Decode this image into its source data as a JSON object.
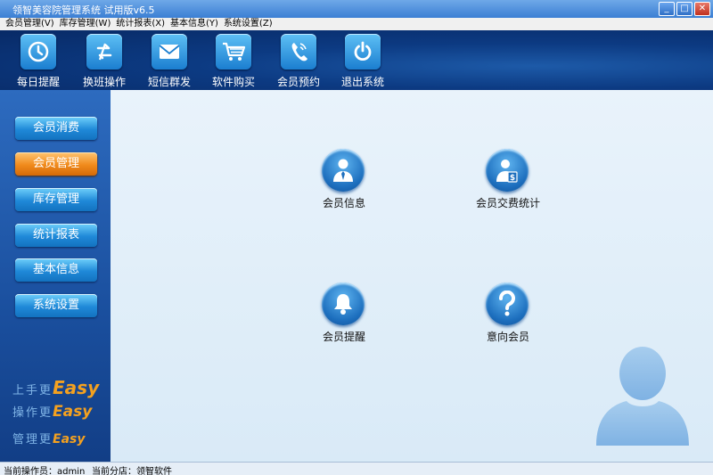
{
  "window": {
    "title": "领智美容院管理系统 试用版v6.5",
    "buttons": {
      "minimize": "_",
      "maximize": "□",
      "close": "✕"
    }
  },
  "menubar": {
    "items": [
      "会员管理(V)",
      "库存管理(W)",
      "统计报表(X)",
      "基本信息(Y)",
      "系统设置(Z)"
    ]
  },
  "toolbar": {
    "items": [
      {
        "label": "每日提醒",
        "icon": "clock-icon"
      },
      {
        "label": "换班操作",
        "icon": "swap-arrows-icon"
      },
      {
        "label": "短信群发",
        "icon": "envelope-icon"
      },
      {
        "label": "软件购买",
        "icon": "cart-icon"
      },
      {
        "label": "会员预约",
        "icon": "phone-icon"
      },
      {
        "label": "退出系统",
        "icon": "power-icon"
      }
    ]
  },
  "sidebar": {
    "items": [
      "会员消费",
      "会员管理",
      "库存管理",
      "统计报表",
      "基本信息",
      "系统设置"
    ],
    "active": "会员管理",
    "slogans": [
      {
        "text": "上手更",
        "easy": "Easy"
      },
      {
        "text": "操作更",
        "easy": "Easy"
      },
      {
        "text": "管理更",
        "easy": "Easy"
      }
    ]
  },
  "main": {
    "features": [
      {
        "label": "会员信息",
        "icon": "member-info-icon"
      },
      {
        "label": "会员交费统计",
        "icon": "member-payment-icon"
      },
      {
        "label": "会员提醒",
        "icon": "bell-icon"
      },
      {
        "label": "意向会员",
        "icon": "question-icon"
      }
    ]
  },
  "statusbar": {
    "operator": "当前操作员：admin",
    "branch": "当前分店：领智软件"
  },
  "colors": {
    "toolbar_bg": "#0c3a82",
    "sidebar_bg": "#1a4f9e",
    "nav_button": "#1f89d8",
    "nav_active": "#f08a1c",
    "main_bg": "#e3eff9",
    "slogan_accent": "#f4a11f"
  }
}
